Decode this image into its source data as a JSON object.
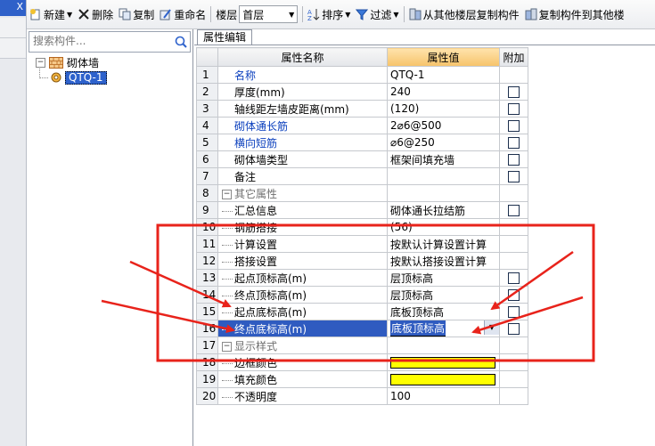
{
  "left_strip": {
    "close_glyph": "X"
  },
  "toolbar": {
    "new_label": "新建",
    "delete_label": "删除",
    "copy_label": "复制",
    "rename_label": "重命名",
    "floor_label": "楼层",
    "floor_value": "首层",
    "sort_label": "排序",
    "filter_label": "过滤",
    "copy_from_floor_label": "从其他楼层复制构件",
    "copy_to_floor_label": "复制构件到其他楼"
  },
  "search": {
    "placeholder": "搜索构件..."
  },
  "tree": {
    "root_label": "砌体墙",
    "child_label": "QTQ-1"
  },
  "prop_panel": {
    "tab_label": "属性编辑"
  },
  "grid": {
    "headers": {
      "name": "属性名称",
      "value": "属性值",
      "extra": "附加"
    },
    "rows": [
      {
        "num": "1",
        "name": "名称",
        "value": "QTQ-1"
      },
      {
        "num": "2",
        "name": "厚度(mm)",
        "value": "240"
      },
      {
        "num": "3",
        "name": "轴线距左墙皮距离(mm)",
        "value": "(120)"
      },
      {
        "num": "4",
        "name": "砌体通长筋",
        "value": "2⌀6@500"
      },
      {
        "num": "5",
        "name": "横向短筋",
        "value": "⌀6@250"
      },
      {
        "num": "6",
        "name": "砌体墙类型",
        "value": "框架间填充墙"
      },
      {
        "num": "7",
        "name": "备注",
        "value": ""
      },
      {
        "num": "8",
        "name": "其它属性",
        "value": ""
      },
      {
        "num": "9",
        "name": "汇总信息",
        "value": "砌体通长拉结筋"
      },
      {
        "num": "10",
        "name": "钢筋搭接",
        "value": "(56)"
      },
      {
        "num": "11",
        "name": "计算设置",
        "value": "按默认计算设置计算"
      },
      {
        "num": "12",
        "name": "搭接设置",
        "value": "按默认搭接设置计算"
      },
      {
        "num": "13",
        "name": "起点顶标高(m)",
        "value": "层顶标高"
      },
      {
        "num": "14",
        "name": "终点顶标高(m)",
        "value": "层顶标高"
      },
      {
        "num": "15",
        "name": "起点底标高(m)",
        "value": "底板顶标高"
      },
      {
        "num": "16",
        "name": "终点底标高(m)",
        "value": "底板顶标高"
      },
      {
        "num": "17",
        "name": "显示样式",
        "value": ""
      },
      {
        "num": "18",
        "name": "边框颜色",
        "value": ""
      },
      {
        "num": "19",
        "name": "填充颜色",
        "value": ""
      },
      {
        "num": "20",
        "name": "不透明度",
        "value": "100"
      }
    ]
  },
  "colors": {
    "selection": "#2f5bc0",
    "annotation_red": "#e8231b",
    "swatch_yellow": "#ffff00",
    "header_highlight": "#f6c36a"
  }
}
